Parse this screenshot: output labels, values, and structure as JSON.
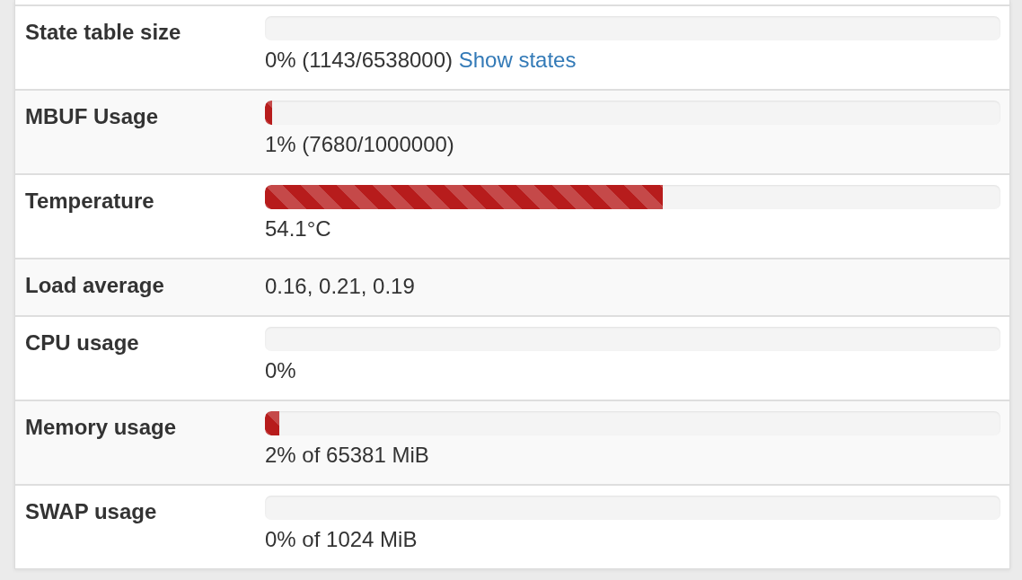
{
  "rows": [
    {
      "label": "State table size",
      "kind": "bar",
      "level": 0,
      "reading": "0% (1143/6538000)",
      "link": "Show states"
    },
    {
      "label": "MBUF Usage",
      "kind": "bar",
      "level": 0.01,
      "reading": "1% (7680/1000000)"
    },
    {
      "label": "Temperature",
      "kind": "bar",
      "level": 0.541,
      "reading": "54.1°C"
    },
    {
      "label": "Load average",
      "kind": "text",
      "value": "0.16, 0.21, 0.19"
    },
    {
      "label": "CPU usage",
      "kind": "bar",
      "level": 0,
      "reading": "0%"
    },
    {
      "label": "Memory usage",
      "kind": "bar",
      "level": 0.02,
      "reading": "2% of 65381 MiB"
    },
    {
      "label": "SWAP usage",
      "kind": "bar",
      "level": 0,
      "reading": "0% of 1024 MiB"
    }
  ]
}
